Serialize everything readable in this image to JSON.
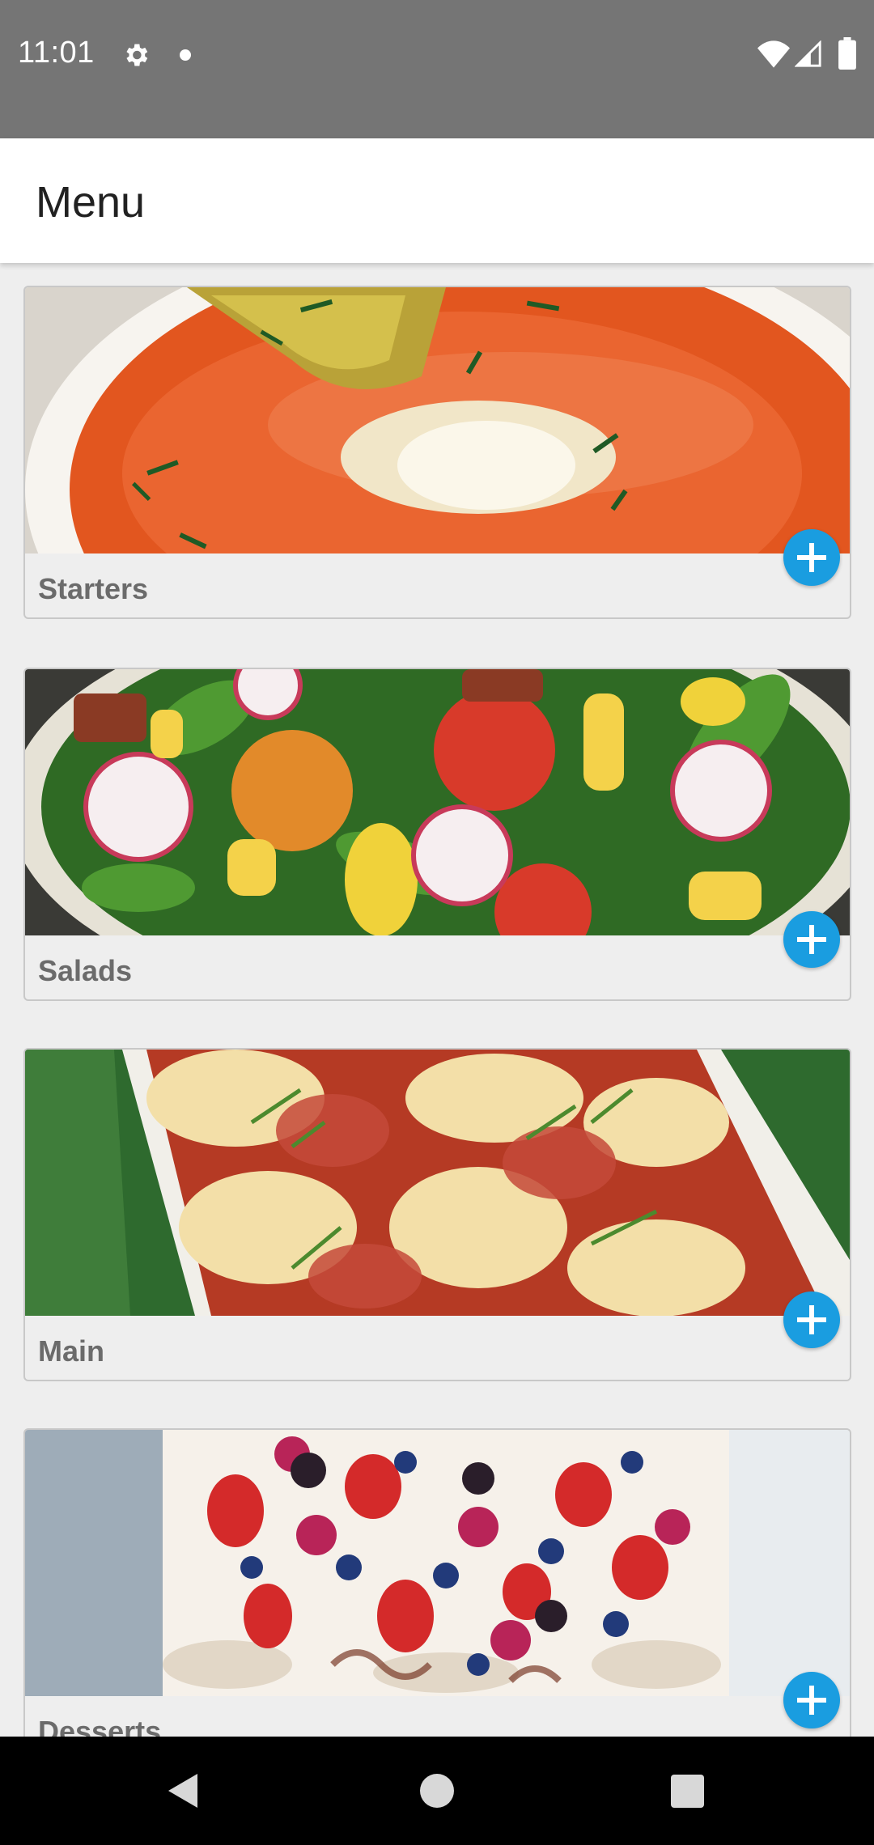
{
  "status_bar": {
    "time": "11:01",
    "icons": [
      "gear-icon",
      "notification-dot-icon",
      "wifi-icon",
      "cell-signal-icon",
      "battery-icon"
    ]
  },
  "app_bar": {
    "title": "Menu"
  },
  "colors": {
    "accent": "#1a9de0",
    "status_bar": "#757575",
    "background": "#eeeeee"
  },
  "menu": {
    "categories": [
      {
        "label": "Starters",
        "image": "tomato-soup-photo"
      },
      {
        "label": "Salads",
        "image": "tomato-radish-salad-photo"
      },
      {
        "label": "Main",
        "image": "prosciutto-chicken-photo"
      },
      {
        "label": "Desserts",
        "image": "berry-pavlova-photo"
      }
    ]
  },
  "nav_bar": {
    "icons": [
      "back-icon",
      "home-icon",
      "recents-icon"
    ]
  }
}
